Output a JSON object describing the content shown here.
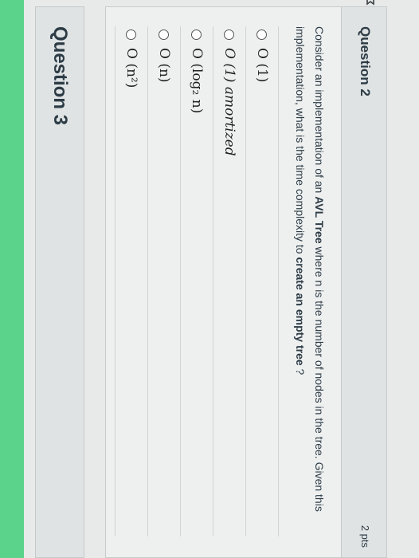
{
  "question2": {
    "title": "Question 2",
    "points": "2 pts",
    "text_parts": {
      "p1": "Consider an implementation of an ",
      "bold1": "AVL Tree",
      "p2": " where n is the number of nodes in the tree. Given this implementation, what is the time complexity to ",
      "bold2": "create an empty tree",
      "p3": " ?"
    },
    "answers": [
      {
        "label": "O (1)"
      },
      {
        "label": "O (1) amortized"
      },
      {
        "label": "O (log₂ n)"
      },
      {
        "label": "O (n)"
      },
      {
        "label": "O (n²)"
      }
    ]
  },
  "question3": {
    "title": "Question 3"
  }
}
